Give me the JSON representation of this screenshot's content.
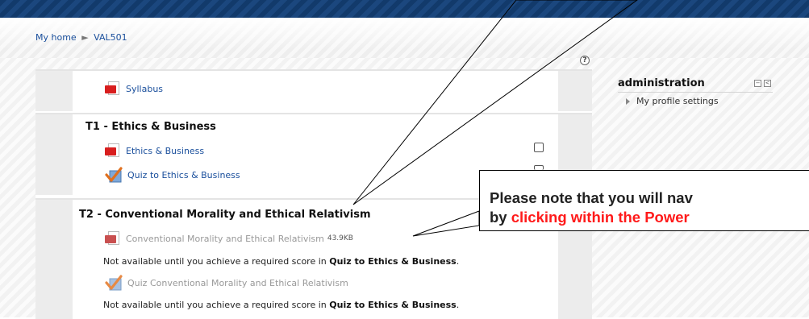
{
  "breadcrumb": {
    "home": "My home",
    "separator": "►",
    "course": "VAL501"
  },
  "sections": {
    "syllabus": {
      "label": "Syllabus"
    },
    "t1": {
      "title": "T1 - Ethics & Business",
      "items": [
        "Ethics & Business",
        "Quiz to Ethics & Business"
      ]
    },
    "t2": {
      "title": "T2 - Conventional Morality and Ethical Relativism",
      "file_label": "Conventional Morality and Ethical Relativism",
      "file_size": "43.9KB",
      "note_prefix": "Not available until you achieve a required score in",
      "note_quiz": "Quiz to Ethics & Business",
      "note_suffix": ".",
      "quiz_label": "Quiz Conventional Morality and Ethical Relativism"
    }
  },
  "admin_block": {
    "title": "administration",
    "collapse_symbol": "−",
    "dock_symbol": "<",
    "item": "My profile settings"
  },
  "help_symbol": "?",
  "callout": {
    "line1": "Please note that you will nav",
    "line2_prefix": "by ",
    "line2_red": "clicking within the Power"
  },
  "colors": {
    "link": "#1a4f9c",
    "dim": "#999999",
    "accent_red": "#ff1a1a",
    "topbar": "#123a6b"
  }
}
